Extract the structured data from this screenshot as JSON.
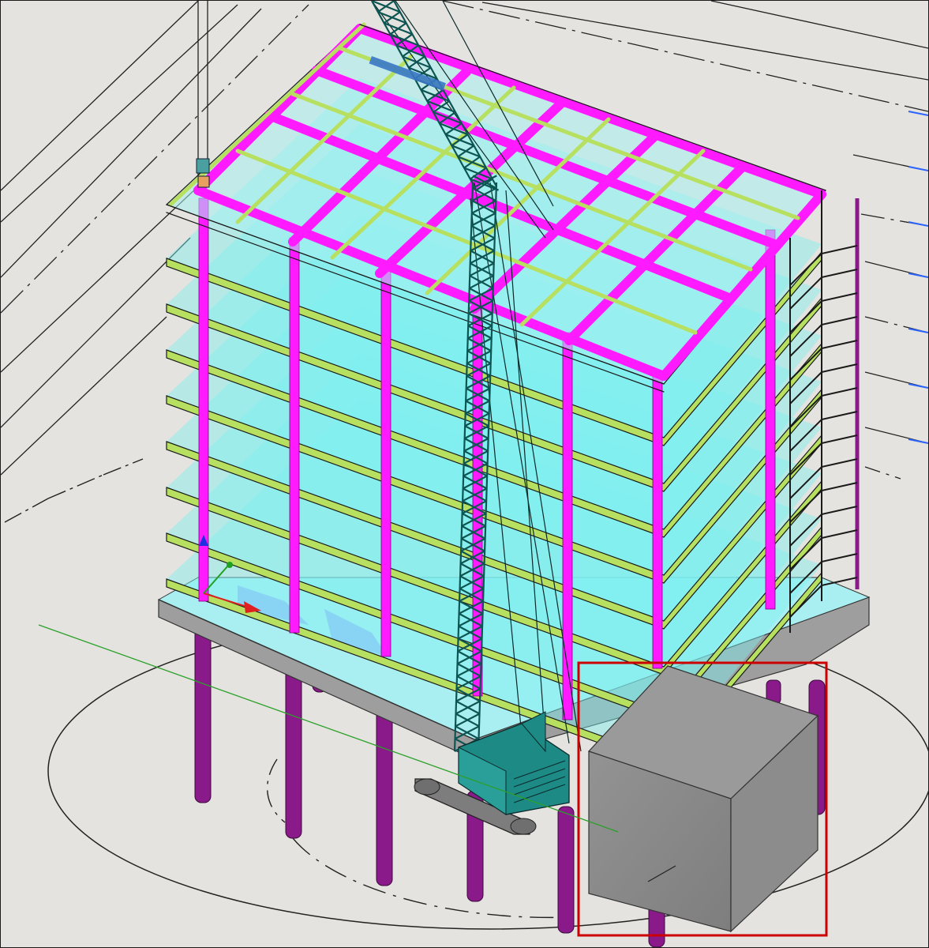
{
  "scene": {
    "view": "3D isometric model viewport",
    "subject": "multi-storey steel frame building with crawler crane",
    "floor_levels": 9,
    "colors": {
      "background": "#e4e3df",
      "columns": "#ff1aff",
      "beams": "#ff33ff",
      "slabs": "#7ff0f0",
      "secondary_beams": "#b8e060",
      "piles": "#8a1a8a",
      "crane": "#1f8a86",
      "crane_track": "#7d7d7d",
      "obstacle_block": "#8a8a8a",
      "selection_box": "#cc0000",
      "grid_lines": "#1a1a1a",
      "blue_ticks": "#2b63ff",
      "axis_x": "#e02020",
      "axis_y": "#20a020",
      "axis_z": "#2030e0",
      "guide_line": "#2aa02a"
    },
    "icons": [
      "axis-triad-icon"
    ]
  }
}
